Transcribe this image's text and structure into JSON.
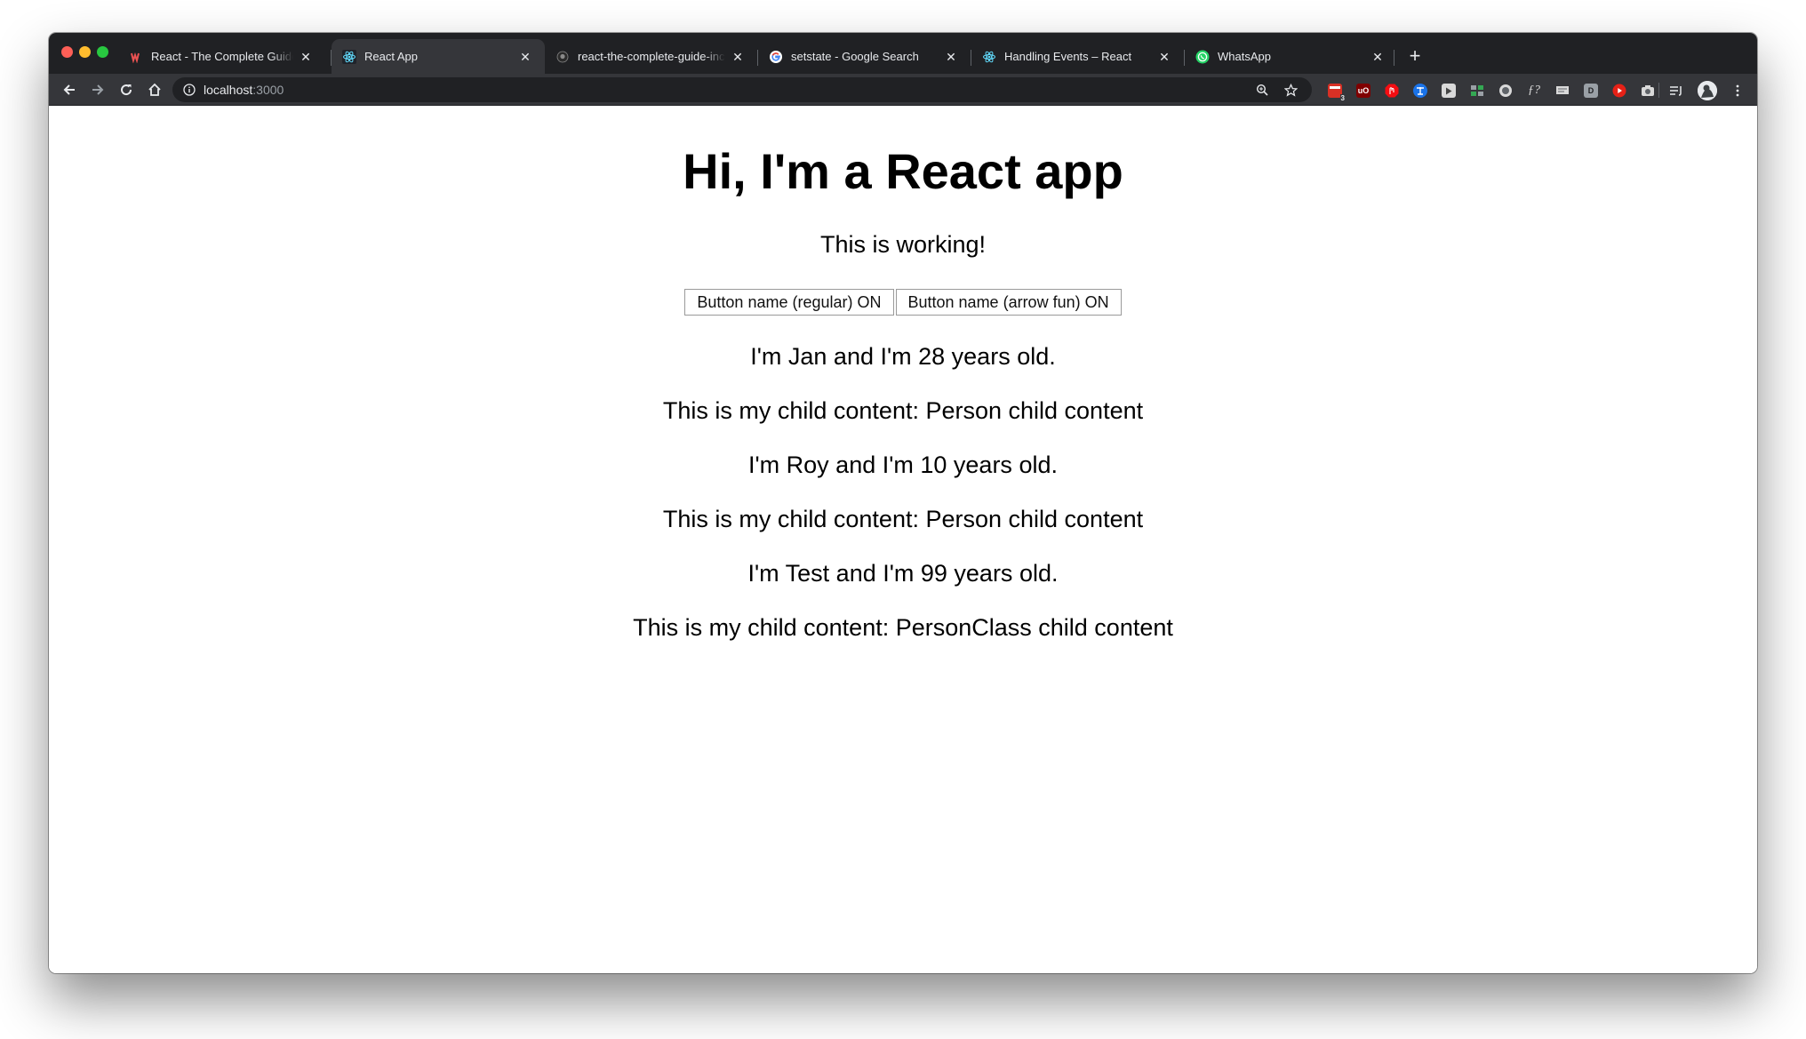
{
  "browser": {
    "tabs": [
      {
        "title": "React - The Complete Guide (i",
        "icon": "udemy-icon",
        "active": false
      },
      {
        "title": "React App",
        "icon": "react-icon",
        "active": true
      },
      {
        "title": "react-the-complete-guide-incl",
        "icon": "github-icon",
        "active": false
      },
      {
        "title": "setstate - Google Search",
        "icon": "google-icon",
        "active": false
      },
      {
        "title": "Handling Events – React",
        "icon": "react-icon",
        "active": false
      },
      {
        "title": "WhatsApp",
        "icon": "whatsapp-icon",
        "active": false
      }
    ],
    "address": {
      "host": "localhost",
      "port": ":3000"
    },
    "extension_badge": "3"
  },
  "page": {
    "heading": "Hi, I'm a React app",
    "status_text": "This is working!",
    "buttons": [
      {
        "label": "Button name (regular) ON"
      },
      {
        "label": "Button name (arrow fun) ON"
      }
    ],
    "persons": [
      {
        "intro": "I'm Jan and I'm 28 years old.",
        "child": "This is my child content: Person child content"
      },
      {
        "intro": "I'm Roy and I'm 10 years old.",
        "child": "This is my child content: Person child content"
      },
      {
        "intro": "I'm Test and I'm 99 years old.",
        "child": "This is my child content: PersonClass child content"
      }
    ]
  },
  "colors": {
    "tabstrip": "#202124",
    "toolbar": "#35363a",
    "page_bg": "#ffffff"
  }
}
